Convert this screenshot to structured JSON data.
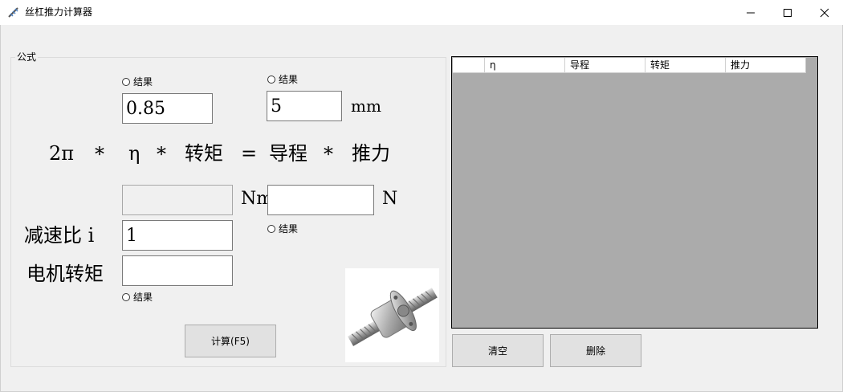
{
  "window": {
    "title": "丝杠推力计算器",
    "controls": [
      "minimize",
      "maximize",
      "close"
    ]
  },
  "formula_group": {
    "label": "公式",
    "efficiency": {
      "radio_label": "结果",
      "value": "0.85"
    },
    "lead": {
      "radio_label": "结果",
      "value": "5",
      "unit": "mm"
    },
    "equation": {
      "two_pi": "2π",
      "op1": "*",
      "eta": "η",
      "op2": "*",
      "torque": "转矩",
      "equals": "=",
      "lead": "导程",
      "op3": "*",
      "thrust": "推力"
    },
    "torque": {
      "value": "",
      "unit": "Nm"
    },
    "thrust": {
      "value": "",
      "unit": "N",
      "radio_label": "结果"
    },
    "ratio": {
      "label": "减速比 i",
      "value": "1"
    },
    "motor_torque": {
      "label": "电机转矩",
      "value": "",
      "radio_label": "结果"
    },
    "calc_button": "计算(F5)"
  },
  "results_table": {
    "columns": [
      "",
      "η",
      "导程",
      "转矩",
      "推力"
    ],
    "rows": []
  },
  "buttons": {
    "clear": "清空",
    "delete": "删除"
  },
  "image": {
    "subject": "ball screw"
  }
}
